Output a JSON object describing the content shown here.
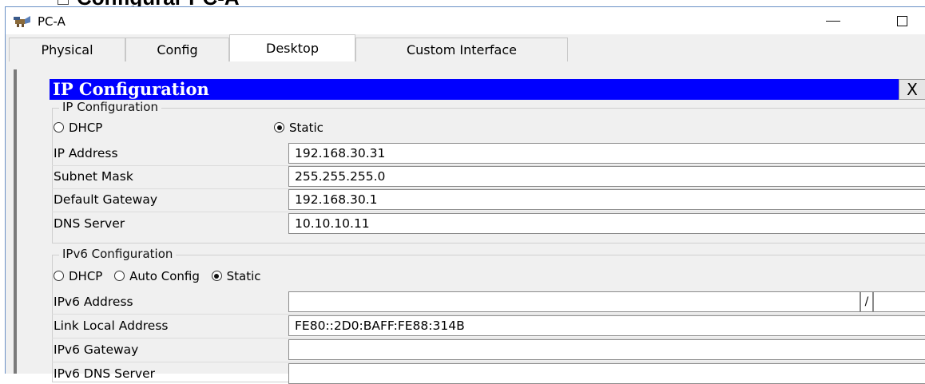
{
  "document": {
    "heading": "Configurar PC-A"
  },
  "window": {
    "title": "PC-A",
    "minimize_glyph": "—",
    "maximize_glyph": "☐"
  },
  "tabs": [
    {
      "label": "Physical",
      "active": false
    },
    {
      "label": "Config",
      "active": false
    },
    {
      "label": "Desktop",
      "active": true
    },
    {
      "label": "Custom Interface",
      "active": false
    }
  ],
  "panel": {
    "title": "IP Configuration",
    "close_label": "X",
    "title_bar_color": "#0000ff"
  },
  "ipv4": {
    "legend": "IP Configuration",
    "mode_options": [
      {
        "label": "DHCP",
        "selected": false
      },
      {
        "label": "Static",
        "selected": true
      }
    ],
    "fields": [
      {
        "label": "IP Address",
        "value": "192.168.30.31"
      },
      {
        "label": "Subnet Mask",
        "value": "255.255.255.0"
      },
      {
        "label": "Default Gateway",
        "value": "192.168.30.1"
      },
      {
        "label": "DNS Server",
        "value": "10.10.10.11"
      }
    ]
  },
  "ipv6": {
    "legend": "IPv6 Configuration",
    "mode_options": [
      {
        "label": "DHCP",
        "selected": false
      },
      {
        "label": "Auto Config",
        "selected": false
      },
      {
        "label": "Static",
        "selected": true
      }
    ],
    "prefix_separator": "/",
    "fields": [
      {
        "label": "IPv6 Address",
        "value": "",
        "prefix": ""
      },
      {
        "label": "Link Local Address",
        "value": "FE80::2D0:BAFF:FE88:314B"
      },
      {
        "label": "IPv6 Gateway",
        "value": ""
      },
      {
        "label": "IPv6 DNS Server",
        "value": ""
      }
    ]
  }
}
